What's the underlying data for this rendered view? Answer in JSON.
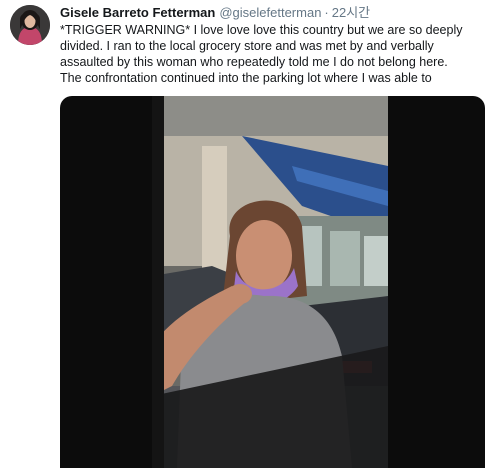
{
  "tweet": {
    "author": {
      "display_name": "Gisele Barreto Fetterman",
      "handle": "@giselefetterman",
      "separator": "·",
      "timestamp": "22시간"
    },
    "text_lines": [
      "*TRIGGER WARNING* I love love love this country but we are so deeply",
      "divided.  I ran to the local grocery store and was met by and verbally",
      "assaulted by this woman who repeatedly told me I do not belong here.",
      "The confrontation continued into the parking lot where I was able to"
    ],
    "media": {
      "type": "video"
    }
  }
}
